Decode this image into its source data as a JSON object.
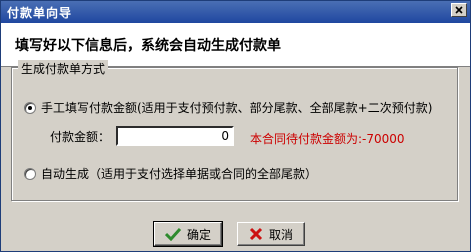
{
  "window": {
    "title": "付款单向导"
  },
  "header": {
    "text": "填写好以下信息后，系统会自动生成付款单"
  },
  "group": {
    "legend": "生成付款单方式",
    "options": [
      {
        "label": "手工填写付款金额(适用于支付预付款、部分尾款、全部尾款+二次预付款)",
        "checked": true
      },
      {
        "label": "自动生成（适用于支付选择单据或合同的全部尾款）",
        "checked": false
      }
    ],
    "amount_label": "付款金额：",
    "amount_value": "0",
    "hint": "本合同待付款金额为:-70000"
  },
  "buttons": {
    "ok": "确定",
    "cancel": "取消"
  },
  "colors": {
    "titlebar": "#1f47a0",
    "hint": "#cc0000",
    "ok_icon": "#2e8b2e",
    "cancel_icon": "#cc1111"
  },
  "icons": {
    "close": "close-icon",
    "ok": "checkmark-icon",
    "cancel": "x-icon"
  }
}
